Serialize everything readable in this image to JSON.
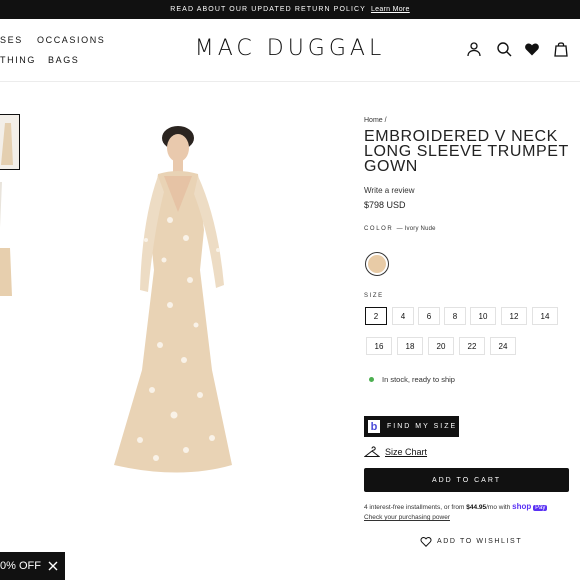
{
  "announcement": {
    "text": "READ ABOUT OUR UPDATED RETURN POLICY",
    "link": "Learn More"
  },
  "nav": {
    "dresses": "SES",
    "occasions": "OCCASIONS",
    "clothing": "THING",
    "bags": "BAGS"
  },
  "brand": "MAC DUGGAL",
  "header_icons": [
    "user-icon",
    "search-icon",
    "heart-icon",
    "bag-icon"
  ],
  "product": {
    "breadcrumb": "Home /",
    "title_lines": [
      "EMBROIDERED V NECK",
      "LONG SLEEVE TRUMPET",
      "GOWN"
    ],
    "review": "Write a review",
    "price": "$798 USD",
    "color_label": "COLOR",
    "color_value": "— Ivory Nude",
    "swatch_color": "#e8cba6",
    "size_label": "SIZE",
    "sizes_row1": [
      "2",
      "4",
      "6",
      "8",
      "10",
      "12",
      "14"
    ],
    "sizes_row2": [
      "16",
      "18",
      "20",
      "22",
      "24"
    ],
    "selected_size": "2",
    "stock": "In stock, ready to ship",
    "find_my_size": "FIND MY SIZE",
    "find_my_size_logo": "b",
    "size_chart": "Size Chart",
    "add_to_cart": "ADD TO CART",
    "shoppay_pre": "4 interest-free installments, or from ",
    "shoppay_amount": "$44.95",
    "shoppay_post": "/mo with ",
    "shoppay_brand": "shop",
    "shoppay_badge": "Pay",
    "shoppay_check": "Check your purchasing power",
    "wishlist": "ADD TO WISHLIST"
  },
  "promo": {
    "text": "0% OFF"
  },
  "colors": {
    "accent": "#111111",
    "stock_dot": "#4caf50",
    "shop_pay": "#5a31f4"
  }
}
